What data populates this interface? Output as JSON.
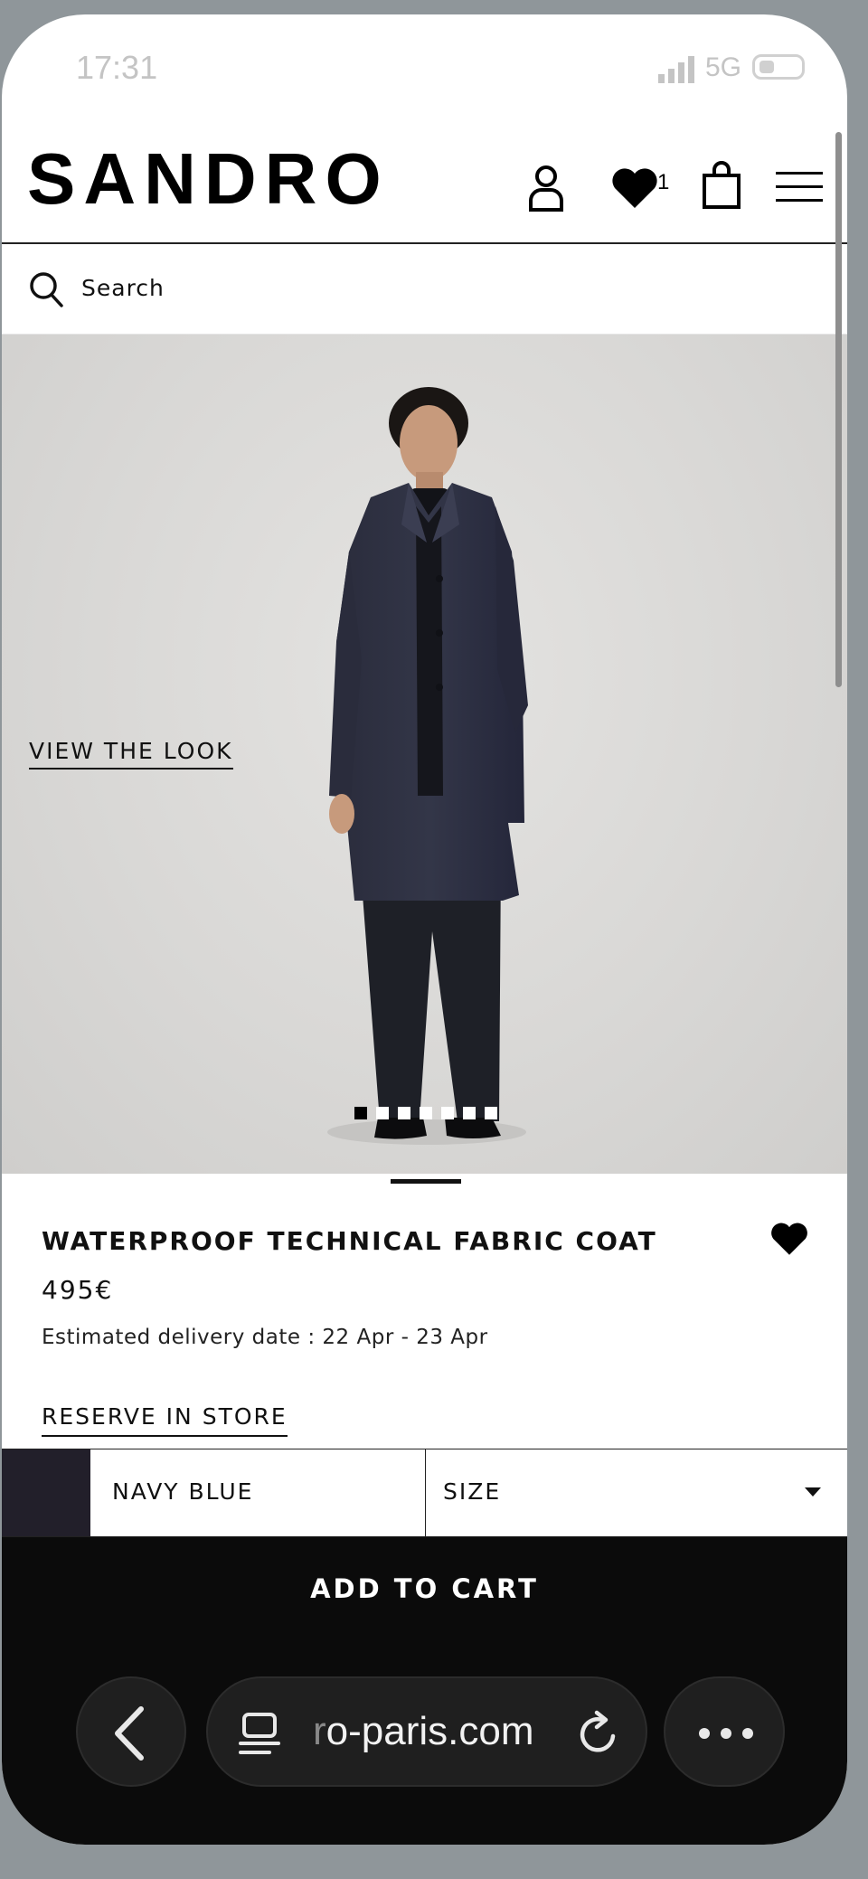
{
  "status_bar": {
    "time": "17:31",
    "network": "5G"
  },
  "header": {
    "logo": "SANDRO",
    "wishlist_count": "1"
  },
  "search": {
    "placeholder": "Search"
  },
  "hero": {
    "view_look_label": "VIEW THE LOOK",
    "carousel_total": 7,
    "carousel_active": 1
  },
  "product": {
    "title": "WATERPROOF TECHNICAL FABRIC COAT",
    "price": "495€",
    "delivery": "Estimated delivery date : 22 Apr - 23 Apr",
    "reserve_label": "RESERVE IN STORE"
  },
  "selector": {
    "color_label": "NAVY BLUE",
    "swatch_color": "#221f2a",
    "size_label": "SIZE"
  },
  "cart": {
    "add_label": "ADD TO CART"
  },
  "browser": {
    "url_faded": "r",
    "url_visible": "o-paris.com"
  },
  "icons": [
    "account-icon",
    "heart-icon",
    "bag-icon",
    "menu-icon",
    "search-icon",
    "back-chevron-icon",
    "tabs-icon",
    "reload-icon",
    "more-icon"
  ]
}
